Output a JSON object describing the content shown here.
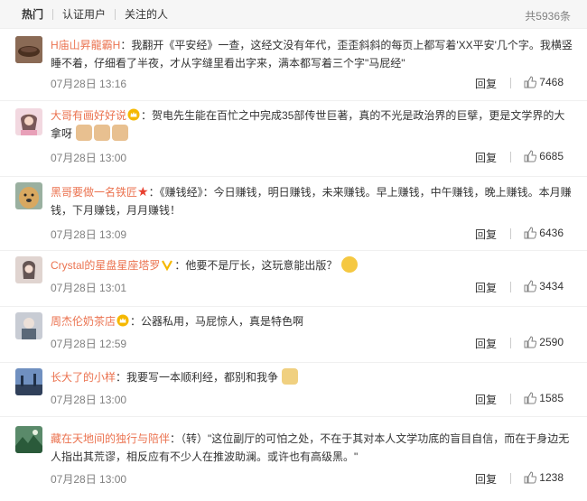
{
  "tabs": {
    "hot": "热门",
    "verified": "认证用户",
    "following": "关注的人",
    "total": "共5936条"
  },
  "comments": [
    {
      "user": "H庙山昇龍霸H",
      "text": "：我翻开《平安经》一查，这经文没有年代，歪歪斜斜的每页上都写着'XX平安'几个字。我横竖睡不着，仔细看了半夜，才从字缝里看出字来，满本都写着三个字\"马屁经\"",
      "time": "07月28日 13:16",
      "reply": "回复",
      "likes": "7468",
      "avatar_color": "#6b4a3a"
    },
    {
      "user": "大哥有画好好说",
      "text": "：贺电先生能在百忙之中完成35部传世巨著，真的不光是政治界的巨擘，更是文学界的大拿呀",
      "time": "07月28日 13:00",
      "reply": "回复",
      "likes": "6685",
      "avatar_color": "#e8b8c8"
    },
    {
      "user": "黑哥要做一名铁匠",
      "text": "：《赚钱经》：今日赚钱，明日赚钱，未来赚钱。早上赚钱，中午赚钱，晚上赚钱。本月赚钱，下月赚钱，月月赚钱！",
      "time": "07月28日 13:09",
      "reply": "回复",
      "likes": "6436",
      "avatar_color": "#c9a060"
    },
    {
      "user": "Crystal的星盘星座塔罗",
      "text": "：他要不是厅长，这玩意能出版？",
      "time": "07月28日 13:01",
      "reply": "回复",
      "likes": "3434",
      "avatar_color": "#d8c8c0"
    },
    {
      "user": "周杰伦奶茶店",
      "text": "：公器私用，马屁惊人，真是特色啊",
      "time": "07月28日 12:59",
      "reply": "回复",
      "likes": "2590",
      "avatar_color": "#9aa8b8"
    },
    {
      "user": "长大了的小样",
      "text": "：我要写一本顺利经，都别和我争",
      "time": "07月28日 13:00",
      "reply": "回复",
      "likes": "1585",
      "avatar_color": "#4a6a9a"
    },
    {
      "user": "藏在天地间的独行与陪伴",
      "text": "：（转）\"这位副厅的可怕之处，不在于其对本人文学功底的盲目自信，而在于身边无人指出其荒谬，相反应有不少人在推波助澜。或许也有高级黑。\"",
      "time": "07月28日 13:00",
      "reply": "回复",
      "likes": "1238",
      "avatar_color": "#3a6a4a"
    }
  ]
}
